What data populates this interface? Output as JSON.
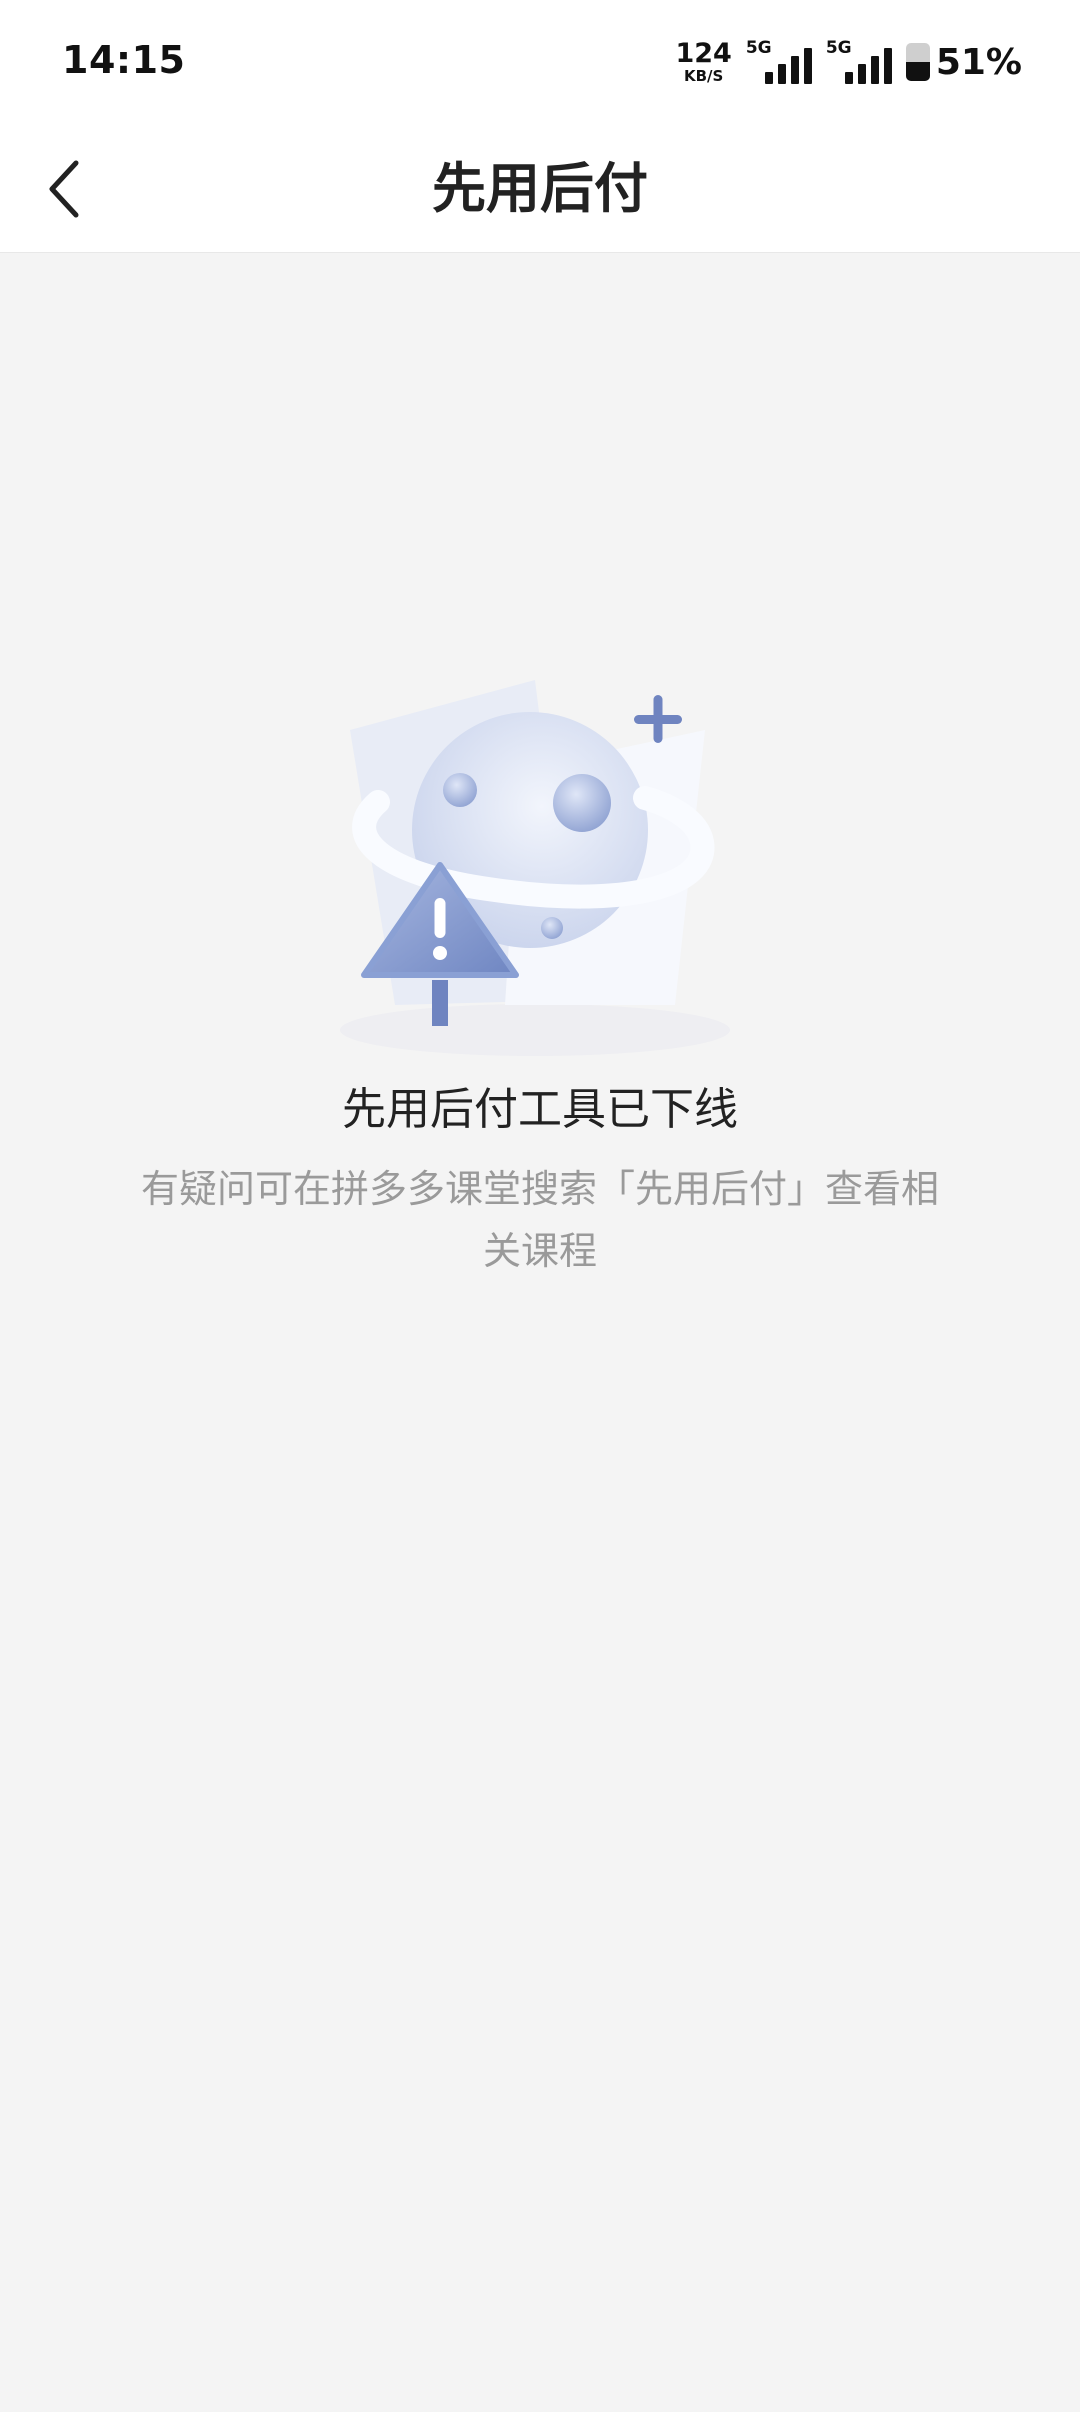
{
  "status_bar": {
    "time": "14:15",
    "net_speed_value": "124",
    "net_speed_unit": "KB/S",
    "sim1_label": "5G",
    "sim2_label": "5G",
    "battery_percent": "51%",
    "battery_level": 0.51
  },
  "nav": {
    "back_icon": "chevron-left-icon",
    "title": "先用后付"
  },
  "empty_state": {
    "illustration_icon": "planet-warning-icon",
    "title": "先用后付工具已下线",
    "description": "有疑问可在拼多多课堂搜索「先用后付」查看相关课程"
  },
  "colors": {
    "background": "#f4f4f4",
    "header": "#ffffff",
    "illustration_accent": "#7f95c8"
  }
}
